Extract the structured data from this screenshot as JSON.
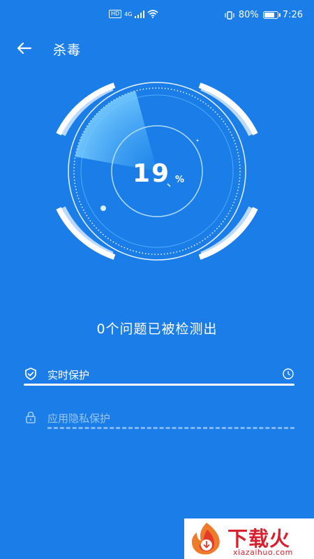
{
  "status_bar": {
    "hd": "HD",
    "network": "4G",
    "battery_percent": "80%",
    "battery_level": 0.8,
    "time": "7:26"
  },
  "header": {
    "title": "杀毒",
    "back_icon": "arrow-left-icon"
  },
  "scan": {
    "progress_value": "19",
    "progress_unit": "%",
    "progress_fraction": 0.19
  },
  "summary_text": "0个问题已被检测出",
  "protections": [
    {
      "label": "实时保护",
      "icon": "shield-check-icon",
      "status_icon": "clock-icon",
      "active": true
    },
    {
      "label": "应用隐私保护",
      "icon": "lock-icon",
      "active": false
    }
  ],
  "watermark": {
    "text": "下载火",
    "subtext": "xiazaihuo.com"
  },
  "colors": {
    "background": "#1a7de8",
    "accent_light": "#7fd0ff",
    "watermark_red": "#d9202f"
  }
}
